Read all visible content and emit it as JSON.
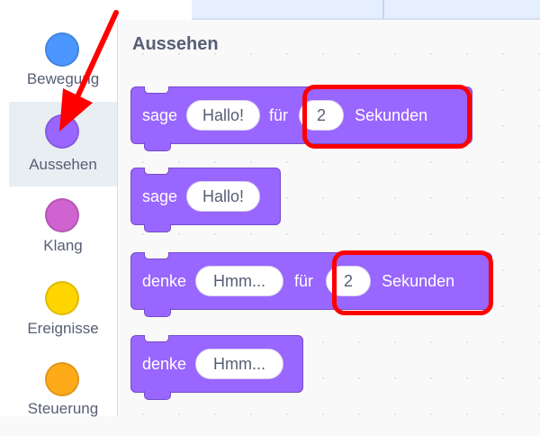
{
  "colors": {
    "motion": "#4c97ff",
    "looks": "#9966ff",
    "sound": "#cf63cf",
    "events": "#ffd500",
    "control": "#ffab19",
    "highlight": "#ff0000",
    "arrow": "#ff0000"
  },
  "sidebar": {
    "items": [
      {
        "label": "Bewegung",
        "icon": "motion-dot-icon"
      },
      {
        "label": "Aussehen",
        "icon": "looks-dot-icon",
        "selected": true
      },
      {
        "label": "Klang",
        "icon": "sound-dot-icon"
      },
      {
        "label": "Ereignisse",
        "icon": "events-dot-icon"
      },
      {
        "label": "Steuerung",
        "icon": "control-dot-icon"
      }
    ]
  },
  "palette": {
    "title": "Aussehen",
    "blocks": {
      "say_for": {
        "w1": "sage",
        "arg1": "Hallo!",
        "w2": "für",
        "arg2": "2",
        "w3": "Sekunden"
      },
      "say": {
        "w1": "sage",
        "arg1": "Hallo!"
      },
      "think_for": {
        "w1": "denke",
        "arg1": "Hmm...",
        "w2": "für",
        "arg2": "2",
        "w3": "Sekunden"
      },
      "think": {
        "w1": "denke",
        "arg1": "Hmm..."
      }
    }
  }
}
